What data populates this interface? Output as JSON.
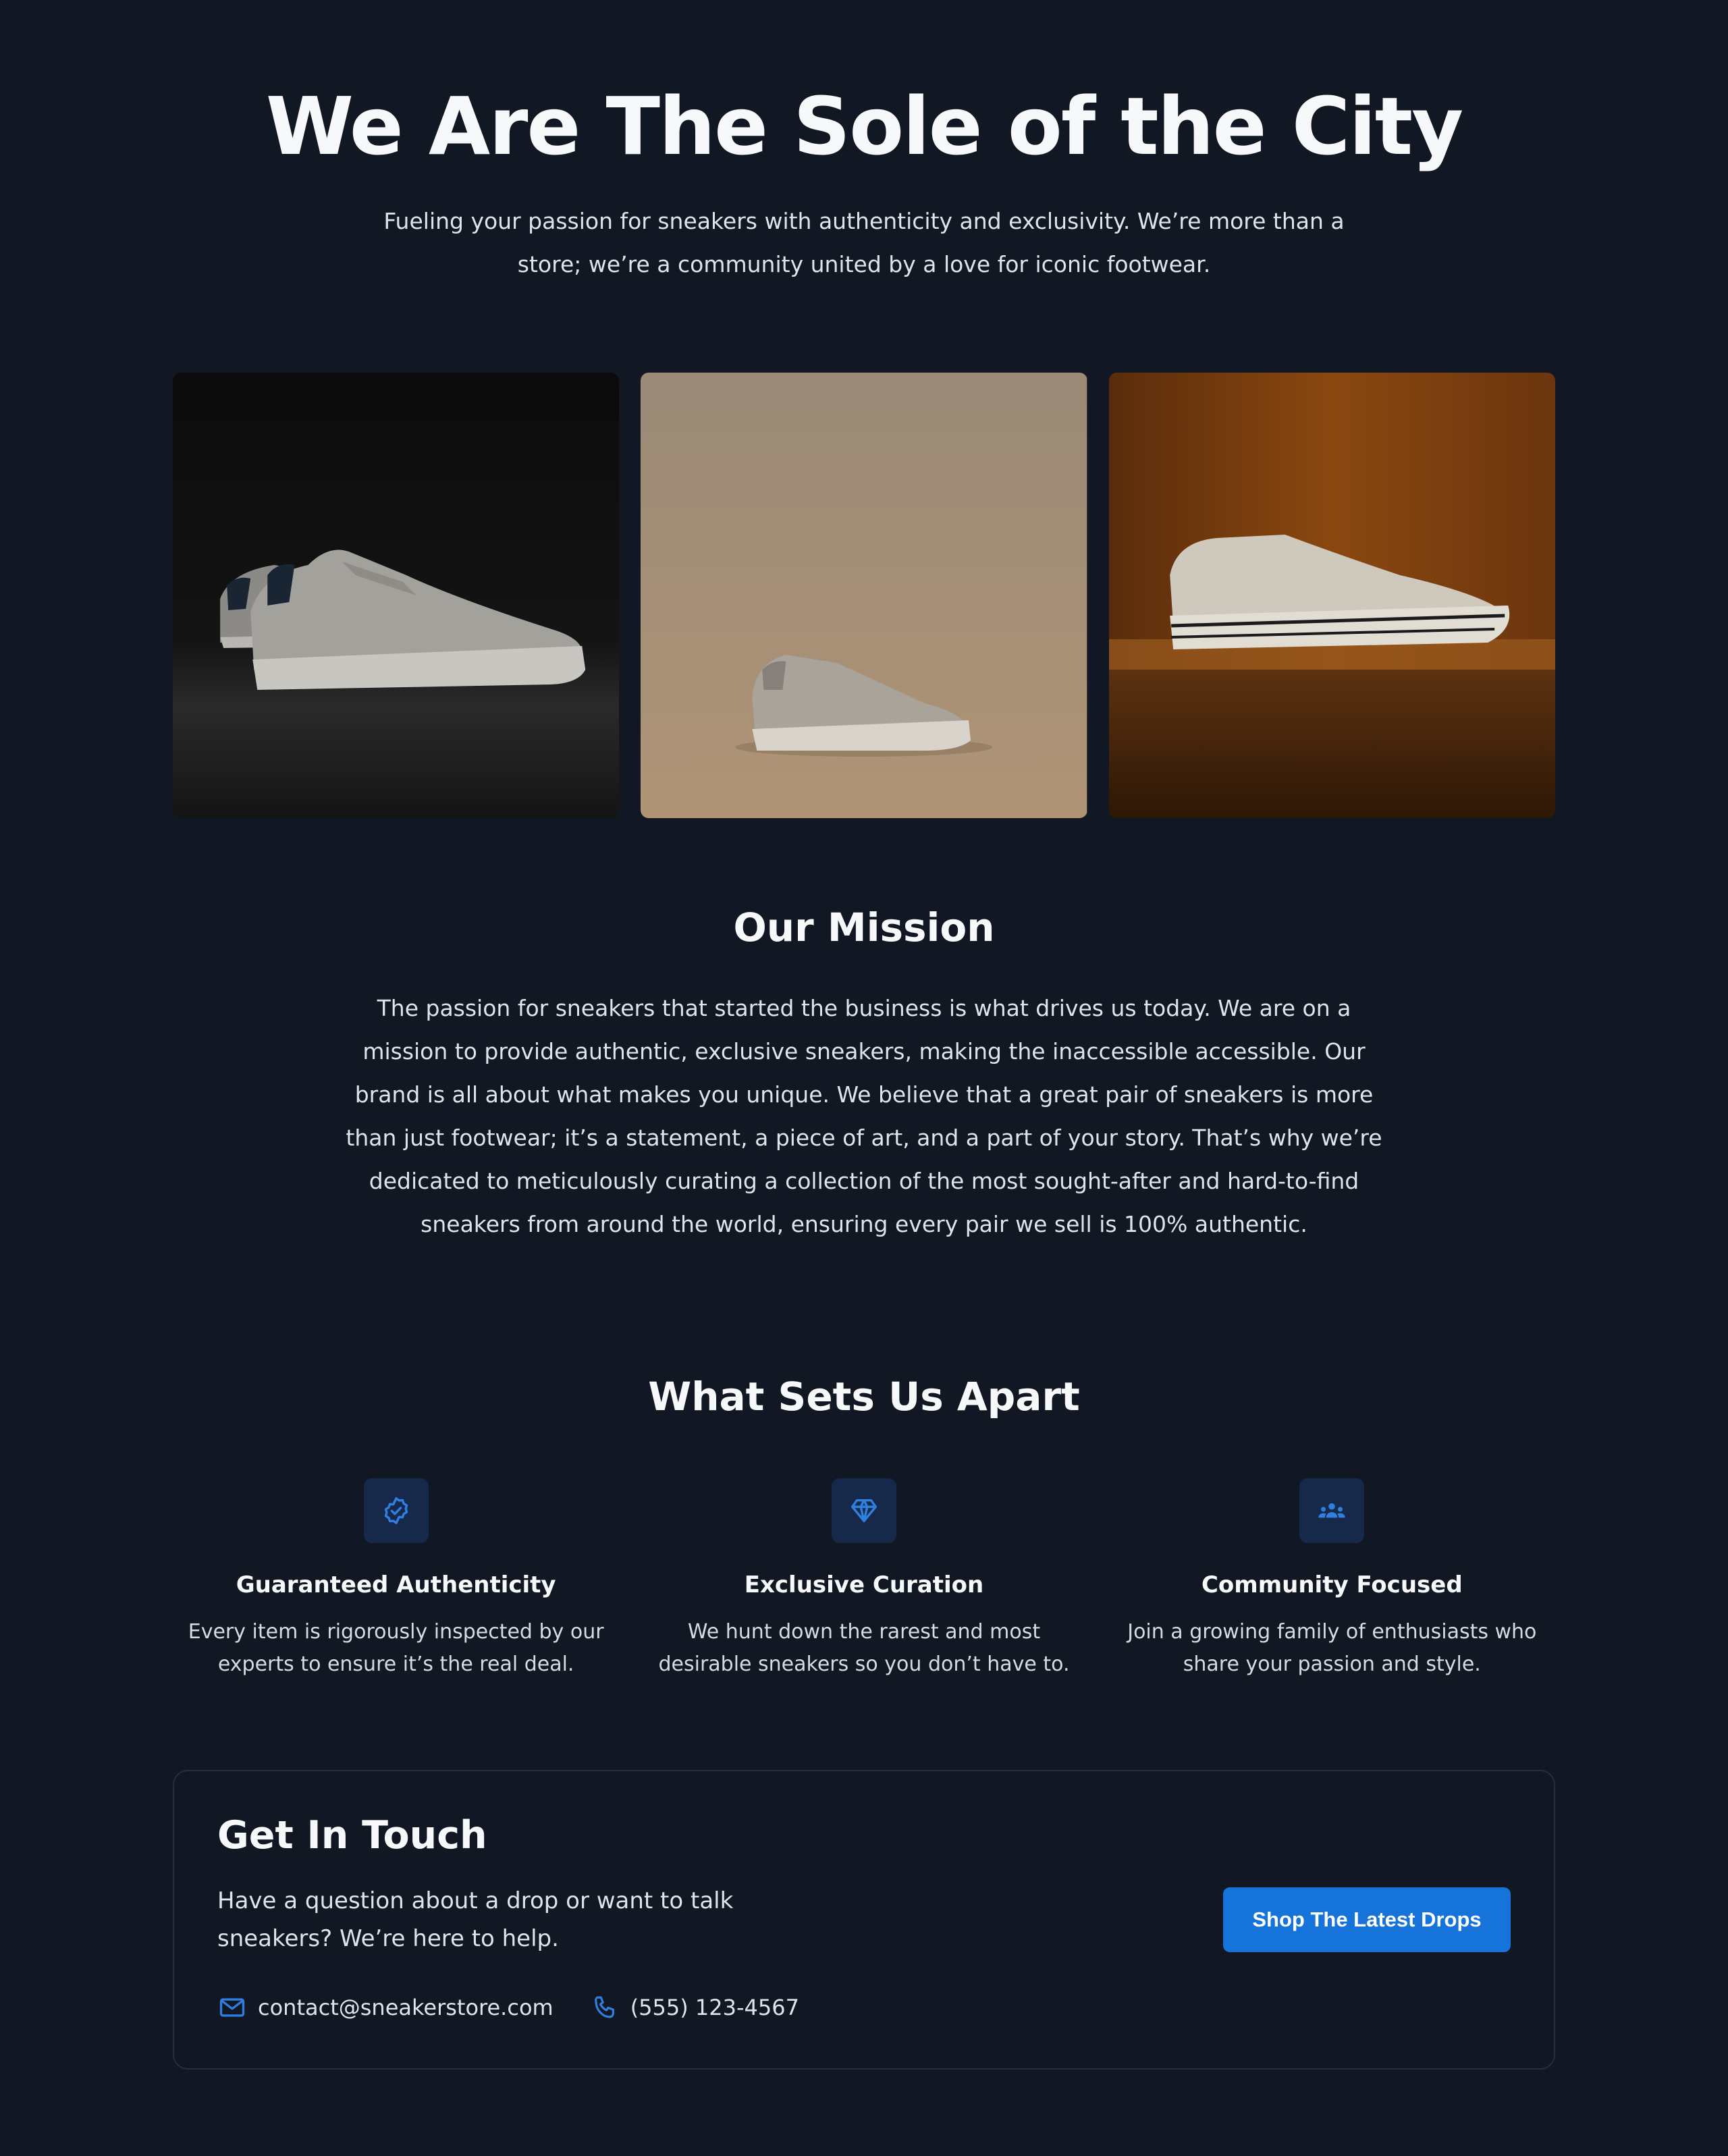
{
  "hero": {
    "title": "We Are The Sole of the City",
    "subtitle": "Fueling your passion for sneakers with authenticity and exclusivity. We’re more than a store; we’re a community united by a love for iconic footwear."
  },
  "gallery": {
    "images": [
      {
        "name": "sneaker-photo-dark"
      },
      {
        "name": "sneaker-photo-beige"
      },
      {
        "name": "sneaker-photo-wood"
      }
    ]
  },
  "mission": {
    "title": "Our Mission",
    "text": "The passion for sneakers that started the business is what drives us today. We are on a mission to provide authentic, exclusive sneakers, making the inaccessible accessible. Our brand is all about what makes you unique. We believe that a great pair of sneakers is more than just footwear; it’s a statement, a piece of art, and a part of your story. That’s why we’re dedicated to meticulously curating a collection of the most sought-after and hard-to-find sneakers from around the world, ensuring every pair we sell is 100% authentic."
  },
  "apart": {
    "title": "What Sets Us Apart",
    "features": [
      {
        "icon": "badge-check-icon",
        "title": "Guaranteed Authenticity",
        "text": "Every item is rigorously inspected by our experts to ensure it’s the real deal."
      },
      {
        "icon": "diamond-icon",
        "title": "Exclusive Curation",
        "text": "We hunt down the rarest and most desirable sneakers so you don’t have to."
      },
      {
        "icon": "people-group-icon",
        "title": "Community Focused",
        "text": "Join a growing family of enthusiasts who share your passion and style."
      }
    ]
  },
  "contact": {
    "title": "Get In Touch",
    "description": "Have a question about a drop or want to talk sneakers? We’re here to help.",
    "email": "contact@sneakerstore.com",
    "phone": "(555) 123-4567",
    "cta_label": "Shop The Latest Drops"
  },
  "colors": {
    "background": "#111823",
    "accent": "#1673d9",
    "icon_tile": "#16294a"
  }
}
